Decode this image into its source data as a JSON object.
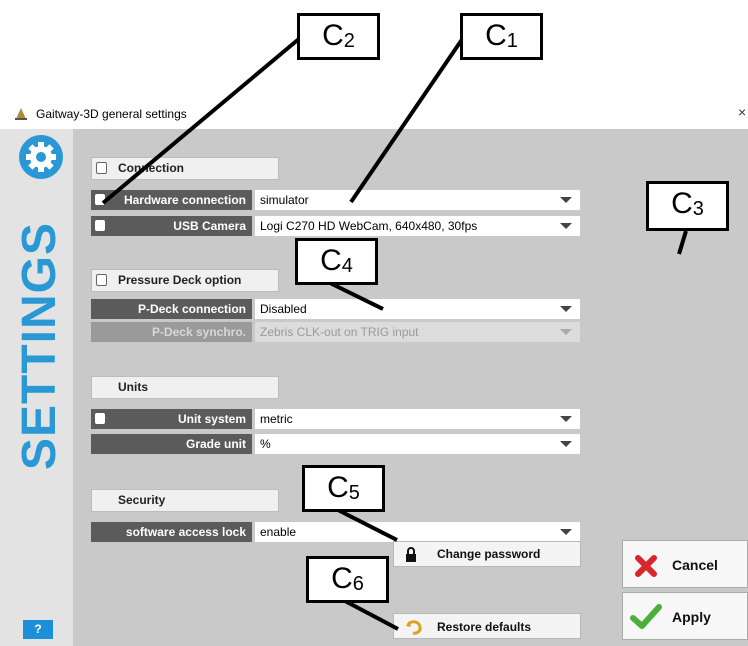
{
  "window": {
    "title": "Gaitway-3D general settings",
    "close": "×"
  },
  "sidebar": {
    "vertical_text": "SETTINGS",
    "help_label": "?"
  },
  "connection": {
    "header": "Connection",
    "hardware_label": "Hardware connection",
    "hardware_value": "simulator",
    "usb_label": "USB Camera",
    "usb_value": "Logi C270 HD WebCam, 640x480, 30fps"
  },
  "pressure": {
    "header": "Pressure Deck option",
    "pdeck_label": "P-Deck connection",
    "pdeck_value": "Disabled",
    "sync_label": "P-Deck synchro.",
    "sync_value": "Zebris CLK-out on TRIG input"
  },
  "units": {
    "header": "Units",
    "system_label": "Unit system",
    "system_value": "metric",
    "grade_label": "Grade unit",
    "grade_value": "%"
  },
  "security": {
    "header": "Security",
    "lock_label": "software access lock",
    "lock_value": "enable",
    "change_password": "Change password"
  },
  "actions": {
    "restore": "Restore defaults",
    "cancel": "Cancel",
    "apply": "Apply"
  },
  "callouts": {
    "c1": "C",
    "c1_sub": "1",
    "c2": "C",
    "c2_sub": "2",
    "c3": "C",
    "c3_sub": "3",
    "c4": "C",
    "c4_sub": "4",
    "c5": "C",
    "c5_sub": "5",
    "c6": "C",
    "c6_sub": "6"
  },
  "colors": {
    "accent": "#2a98d5",
    "label_bg": "#5b5b5b",
    "panel_bg": "#c9c9c9"
  }
}
